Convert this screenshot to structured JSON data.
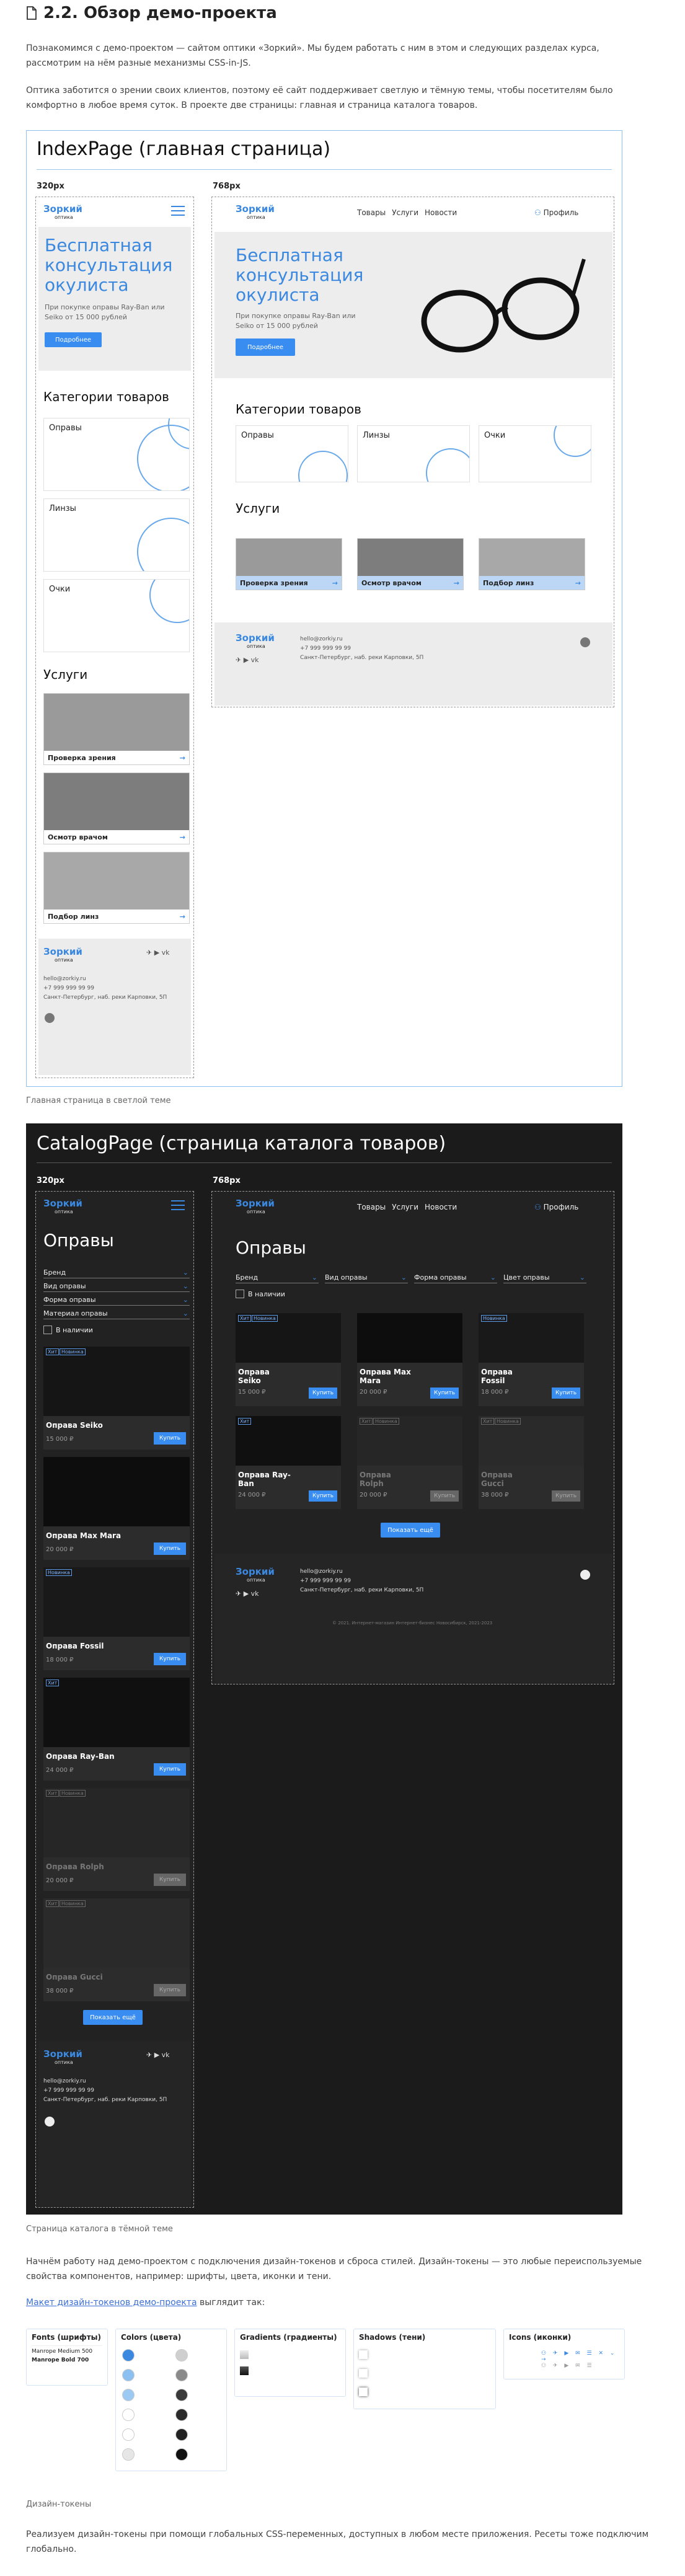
{
  "page": {
    "title": "2.2. Обзор демо-проекта",
    "p1": "Познакомимся с демо-проектом — сайтом оптики «Зоркий». Мы будем работать с ним в этом и следующих разделах курса, рассмотрим на нём разные механизмы CSS-in-JS.",
    "p2": "Оптика заботится о зрении своих клиентов, поэтому её сайт поддерживает светлую и тёмную темы, чтобы посетителям было комфортно в любое время суток. В проекте две страницы: главная и страница каталога товаров.",
    "caption1": "Главная страница в светлой теме",
    "caption2": "Страница каталога в тёмной теме",
    "p3": "Начнём работу над демо-проектом с подключения дизайн-токенов и сброса стилей. Дизайн-токены — это любые переиспользуемые свойства компонентов, например: шрифты, цвета, иконки и тени.",
    "p4_link": "Макет дизайн-токенов демо-проекта",
    "p4_rest": " выглядит так:",
    "caption3": "Дизайн-токены",
    "p5": "Реализуем дизайн-токены при помощи глобальных CSS-переменных, доступных в любом месте приложения. Ресеты тоже подключим глобально."
  },
  "brand": {
    "name": "Зоркий",
    "sub": "оптика"
  },
  "index": {
    "title": "IndexPage (главная страница)",
    "bp_small": "320px",
    "bp_large": "768px",
    "nav": [
      "Товары",
      "Услуги",
      "Новости"
    ],
    "profile": "Профиль",
    "hero_title": "Бесплатная консультация окулиста",
    "hero_text": "При покупке оправы Ray-Ban или Seiko от 15 000 рублей",
    "hero_btn": "Подробнее",
    "categories_title": "Категории товаров",
    "categories": [
      "Оправы",
      "Линзы",
      "Очки"
    ],
    "services_title": "Услуги",
    "services": [
      "Проверка зрения",
      "Осмотр врачом",
      "Подбор линз"
    ],
    "email": "hello@zorkiy.ru",
    "phone": "+7 999 999 99 99",
    "address": "Санкт-Петербург, наб. реки Карповки, 5П"
  },
  "catalog": {
    "title": "CatalogPage (страница каталога товаров)",
    "bp_small": "320px",
    "bp_large": "768px",
    "heading": "Оправы",
    "filters": [
      "Бренд",
      "Вид оправы",
      "Форма оправы",
      "Цвет оправы"
    ],
    "filters_small": [
      "Бренд",
      "Вид оправы",
      "Форма оправы",
      "Материал оправы"
    ],
    "in_stock": "В наличии",
    "buy": "Купить",
    "show_more": "Показать ещё",
    "tags": {
      "hit": "Хит",
      "new": "Новинка"
    },
    "products": [
      {
        "name": "Оправа Seiko",
        "price": "15 000 ₽"
      },
      {
        "name": "Оправа Max Mara",
        "price": "20 000 ₽"
      },
      {
        "name": "Оправа Fossil",
        "price": "18 000 ₽"
      },
      {
        "name": "Оправа Ray-Ban",
        "price": "24 000 ₽"
      },
      {
        "name": "Оправа Rolph",
        "price": "20 000 ₽"
      },
      {
        "name": "Оправа Gucci",
        "price": "38 000 ₽"
      }
    ],
    "copyright": "© 2021. Интернет-магазин Интернет-бизнес Новосибирск, 2021-2023"
  },
  "tokens": {
    "fonts_title": "Fonts (шрифты)",
    "fonts": [
      "Manrope Medium 500",
      "Manrope Bold 700"
    ],
    "colors_title": "Colors (цвета)",
    "colors": [
      "#3a88e0",
      "#8cc0f0",
      "#9ccaf2",
      "#ffffff",
      "#ffffff",
      "#e6e6e6",
      "#cfcfcf",
      "#8a8a8a",
      "#3a3a3a",
      "#2a2a2a",
      "#222222",
      "#111111"
    ],
    "gradients_title": "Gradients (градиенты)",
    "shadows_title": "Shadows (тени)",
    "icons_title": "Icons (иконки)"
  }
}
